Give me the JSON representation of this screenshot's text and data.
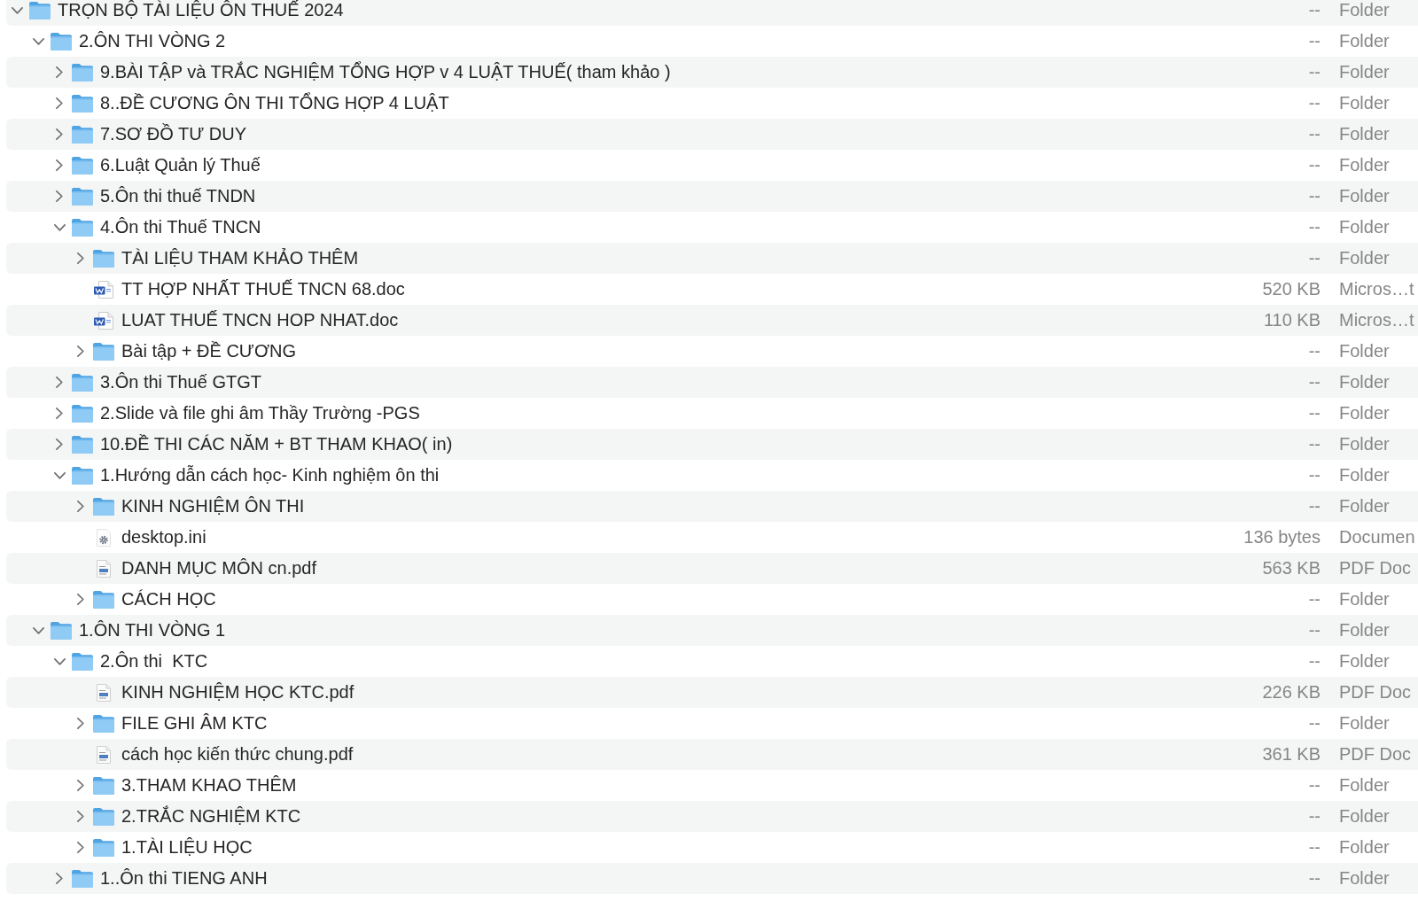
{
  "items": [
    {
      "name": "TRỌN BỘ TÀI LIỆU ÔN THUẾ 2024",
      "kind": "folder",
      "expanded": true,
      "size": "--",
      "type": "Folder",
      "children": [
        {
          "name": "2.ÔN THI VÒNG 2",
          "kind": "folder",
          "expanded": true,
          "size": "--",
          "type": "Folder",
          "children": [
            {
              "name": "9.BÀI TẬP và TRẮC NGHIỆM TỔNG HỢP v 4 LUẬT THUẾ( tham khảo )",
              "kind": "folder",
              "expanded": false,
              "size": "--",
              "type": "Folder"
            },
            {
              "name": "8..ĐỀ CƯƠNG ÔN THI TỔNG HỢP 4 LUẬT",
              "kind": "folder",
              "expanded": false,
              "size": "--",
              "type": "Folder"
            },
            {
              "name": "7.SƠ ĐỒ TƯ DUY",
              "kind": "folder",
              "expanded": false,
              "size": "--",
              "type": "Folder"
            },
            {
              "name": "6.Luật Quản lý Thuế",
              "kind": "folder",
              "expanded": false,
              "size": "--",
              "type": "Folder"
            },
            {
              "name": "5.Ôn thi thuế TNDN",
              "kind": "folder",
              "expanded": false,
              "size": "--",
              "type": "Folder"
            },
            {
              "name": "4.Ôn thi Thuế TNCN",
              "kind": "folder",
              "expanded": true,
              "size": "--",
              "type": "Folder",
              "children": [
                {
                  "name": "TÀI LIỆU THAM KHẢO THÊM",
                  "kind": "folder",
                  "expanded": false,
                  "size": "--",
                  "type": "Folder"
                },
                {
                  "name": "TT HỢP NHẤT THUẾ TNCN 68.doc",
                  "kind": "word",
                  "size": "520 KB",
                  "type": "Micros…t"
                },
                {
                  "name": "LUAT THUẾ TNCN HOP NHAT.doc",
                  "kind": "word",
                  "size": "110 KB",
                  "type": "Micros…t"
                },
                {
                  "name": "Bài tập + ĐỀ CƯƠNG",
                  "kind": "folder",
                  "expanded": false,
                  "size": "--",
                  "type": "Folder"
                }
              ]
            },
            {
              "name": "3.Ôn thi Thuế GTGT",
              "kind": "folder",
              "expanded": false,
              "size": "--",
              "type": "Folder"
            },
            {
              "name": "2.Slide và file ghi âm Thầy Trường -PGS",
              "kind": "folder",
              "expanded": false,
              "size": "--",
              "type": "Folder"
            },
            {
              "name": "10.ĐỀ THI CÁC NĂM + BT THAM KHAO( in)",
              "kind": "folder",
              "expanded": false,
              "size": "--",
              "type": "Folder"
            },
            {
              "name": "1.Hướng dẫn cách học- Kinh nghiệm ôn thi",
              "kind": "folder",
              "expanded": true,
              "size": "--",
              "type": "Folder",
              "children": [
                {
                  "name": "KINH NGHIỆM ÔN THI",
                  "kind": "folder",
                  "expanded": false,
                  "size": "--",
                  "type": "Folder"
                },
                {
                  "name": "desktop.ini",
                  "kind": "settings",
                  "size": "136 bytes",
                  "type": "Documen"
                },
                {
                  "name": "DANH MỤC MÔN cn.pdf",
                  "kind": "pdf",
                  "size": "563 KB",
                  "type": "PDF Doc"
                },
                {
                  "name": "CÁCH HỌC",
                  "kind": "folder",
                  "expanded": false,
                  "size": "--",
                  "type": "Folder"
                }
              ]
            }
          ]
        },
        {
          "name": "1.ÔN THI VÒNG 1",
          "kind": "folder",
          "expanded": true,
          "size": "--",
          "type": "Folder",
          "children": [
            {
              "name": "2.Ôn thi  KTC",
              "kind": "folder",
              "expanded": true,
              "size": "--",
              "type": "Folder",
              "children": [
                {
                  "name": "KINH NGHIỆM HỌC KTC.pdf",
                  "kind": "pdf",
                  "size": "226 KB",
                  "type": "PDF Doc"
                },
                {
                  "name": "FILE GHI ÂM KTC",
                  "kind": "folder",
                  "expanded": false,
                  "size": "--",
                  "type": "Folder"
                },
                {
                  "name": "cách học kiến thức chung.pdf",
                  "kind": "pdf",
                  "size": "361 KB",
                  "type": "PDF Doc"
                },
                {
                  "name": "3.THAM KHAO THÊM",
                  "kind": "folder",
                  "expanded": false,
                  "size": "--",
                  "type": "Folder"
                },
                {
                  "name": "2.TRẮC NGHIỆM KTC",
                  "kind": "folder",
                  "expanded": false,
                  "size": "--",
                  "type": "Folder"
                },
                {
                  "name": "1.TÀI LIỆU HỌC",
                  "kind": "folder",
                  "expanded": false,
                  "size": "--",
                  "type": "Folder"
                }
              ]
            },
            {
              "name": "1..Ôn thi TIENG ANH",
              "kind": "folder",
              "expanded": false,
              "size": "--",
              "type": "Folder"
            }
          ]
        }
      ]
    }
  ]
}
